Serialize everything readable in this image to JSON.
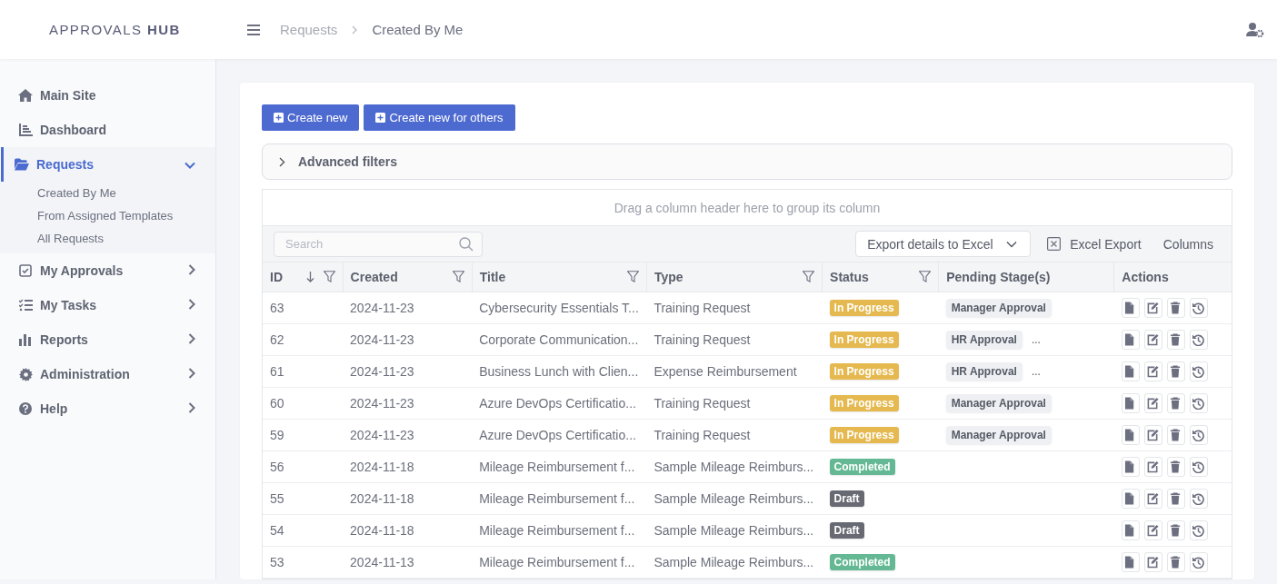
{
  "header": {
    "brand": "APPROVALS **HUB**",
    "breadcrumbs": [
      "Requests",
      "Created By Me"
    ]
  },
  "sidebar": {
    "items": [
      {
        "label": "Main Site",
        "selected": false
      },
      {
        "label": "Dashboard",
        "selected": false
      },
      {
        "label": "Requests",
        "selected": true,
        "expanded": true,
        "children": [
          {
            "label": "Created By Me",
            "selected": false
          },
          {
            "label": "From Assigned Templates",
            "selected": false
          },
          {
            "label": "All Requests",
            "selected": false
          }
        ]
      },
      {
        "label": "My Approvals",
        "selected": false,
        "expanded": false
      },
      {
        "label": "My Tasks",
        "selected": false,
        "expanded": false
      },
      {
        "label": "Reports",
        "selected": false,
        "expanded": false
      },
      {
        "label": "Administration",
        "selected": false,
        "expanded": false
      },
      {
        "label": "Help",
        "selected": false,
        "expanded": false
      }
    ]
  },
  "buttons": [
    "Create new",
    "Create new for others"
  ],
  "advanced_filters": {
    "label": "Advanced filters",
    "expanded": false
  },
  "grid": {
    "group_panel": "Drag a column header here to group its column",
    "search": {
      "placeholder": "Search"
    },
    "export_dropdown": "Export details to Excel",
    "excel_export": "Excel Export",
    "columns_button": "Columns",
    "columns": [
      {
        "label": "ID",
        "sorted": true,
        "filter": true
      },
      {
        "label": "Created",
        "sorted": false,
        "filter": true
      },
      {
        "label": "Title",
        "sorted": false,
        "filter": true
      },
      {
        "label": "Type",
        "sorted": false,
        "filter": true
      },
      {
        "label": "Status",
        "sorted": false,
        "filter": true
      },
      {
        "label": "Pending Stage(s)",
        "sorted": false,
        "filter": false
      },
      {
        "label": "Actions",
        "sorted": false,
        "filter": false
      }
    ],
    "rows": [
      {
        "id": "63",
        "created": "2024-11-23",
        "title": "Cybersecurity Essentials T...",
        "type": "Training Request",
        "status": {
          "label": "In Progress",
          "kind": "progress"
        },
        "pending": [
          "Manager Approval"
        ],
        "more": null
      },
      {
        "id": "62",
        "created": "2024-11-23",
        "title": "Corporate Communication...",
        "type": "Training Request",
        "status": {
          "label": "In Progress",
          "kind": "progress"
        },
        "pending": [
          "HR Approval"
        ],
        "more": "..."
      },
      {
        "id": "61",
        "created": "2024-11-23",
        "title": "Business Lunch with Clien...",
        "type": "Expense Reimbursement",
        "status": {
          "label": "In Progress",
          "kind": "progress"
        },
        "pending": [
          "HR Approval"
        ],
        "more": "..."
      },
      {
        "id": "60",
        "created": "2024-11-23",
        "title": "Azure DevOps Certificatio...",
        "type": "Training Request",
        "status": {
          "label": "In Progress",
          "kind": "progress"
        },
        "pending": [
          "Manager Approval"
        ],
        "more": null
      },
      {
        "id": "59",
        "created": "2024-11-23",
        "title": "Azure DevOps Certificatio...",
        "type": "Training Request",
        "status": {
          "label": "In Progress",
          "kind": "progress"
        },
        "pending": [
          "Manager Approval"
        ],
        "more": null
      },
      {
        "id": "56",
        "created": "2024-11-18",
        "title": "Mileage Reimbursement f...",
        "type": "Sample Mileage Reimburs...",
        "status": {
          "label": "Completed",
          "kind": "completed"
        },
        "pending": [],
        "more": null
      },
      {
        "id": "55",
        "created": "2024-11-18",
        "title": "Mileage Reimbursement f...",
        "type": "Sample Mileage Reimburs...",
        "status": {
          "label": "Draft",
          "kind": "draft"
        },
        "pending": [],
        "more": null
      },
      {
        "id": "54",
        "created": "2024-11-18",
        "title": "Mileage Reimbursement f...",
        "type": "Sample Mileage Reimburs...",
        "status": {
          "label": "Draft",
          "kind": "draft"
        },
        "pending": [],
        "more": null
      },
      {
        "id": "53",
        "created": "2024-11-13",
        "title": "Mileage Reimbursement f...",
        "type": "Sample Mileage Reimburs...",
        "status": {
          "label": "Completed",
          "kind": "completed"
        },
        "pending": [],
        "more": null
      }
    ]
  }
}
